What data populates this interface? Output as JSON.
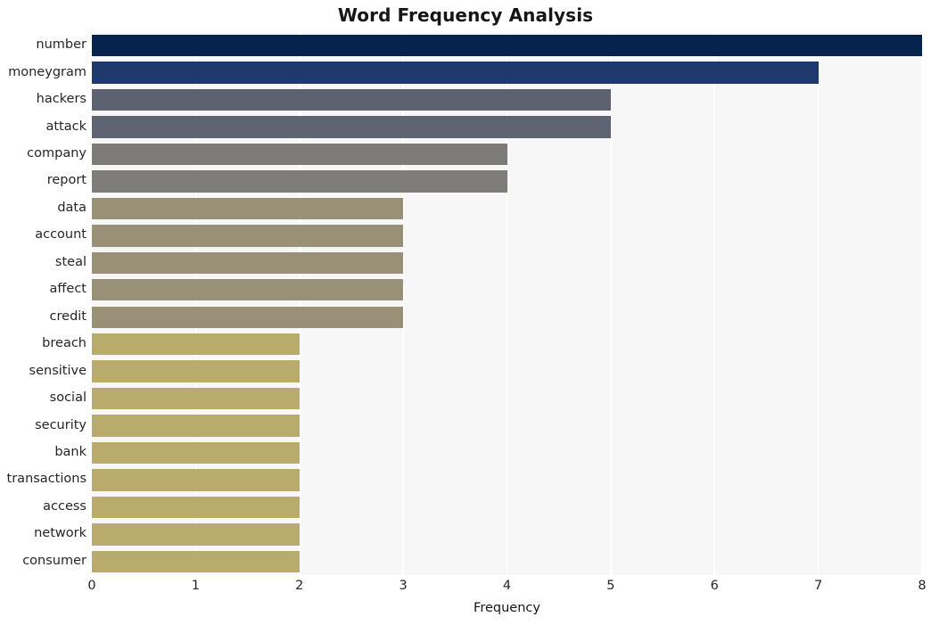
{
  "chart_data": {
    "type": "bar",
    "orientation": "horizontal",
    "title": "Word Frequency Analysis",
    "xlabel": "Frequency",
    "ylabel": "",
    "categories": [
      "number",
      "moneygram",
      "hackers",
      "attack",
      "company",
      "report",
      "data",
      "account",
      "steal",
      "affect",
      "credit",
      "breach",
      "sensitive",
      "social",
      "security",
      "bank",
      "transactions",
      "access",
      "network",
      "consumer"
    ],
    "values": [
      8,
      7,
      5,
      5,
      4,
      4,
      3,
      3,
      3,
      3,
      3,
      2,
      2,
      2,
      2,
      2,
      2,
      2,
      2,
      2
    ],
    "bar_colors": [
      "#06234d",
      "#1e3a6d",
      "#5c6270",
      "#5f6472",
      "#7c7b78",
      "#7e7d79",
      "#989077",
      "#989077",
      "#989077",
      "#989077",
      "#989077",
      "#b9ab6c",
      "#b9ab6c",
      "#b9ab6c",
      "#b9ab6c",
      "#b9ab6c",
      "#b9ab6c",
      "#b9ab6c",
      "#b9ab6c",
      "#b9ab6c"
    ],
    "xlim": [
      0,
      8
    ],
    "xticks": [
      0,
      1,
      2,
      3,
      4,
      5,
      6,
      7,
      8
    ],
    "xtick_labels": [
      "0",
      "1",
      "2",
      "3",
      "4",
      "5",
      "6",
      "7",
      "8"
    ],
    "grid": true,
    "grid_axis": "x",
    "grid_color": "#ffffff",
    "plot_background": "#f7f7f7",
    "figure_background": "#ffffff",
    "legend": null,
    "style": "whitegrid"
  }
}
